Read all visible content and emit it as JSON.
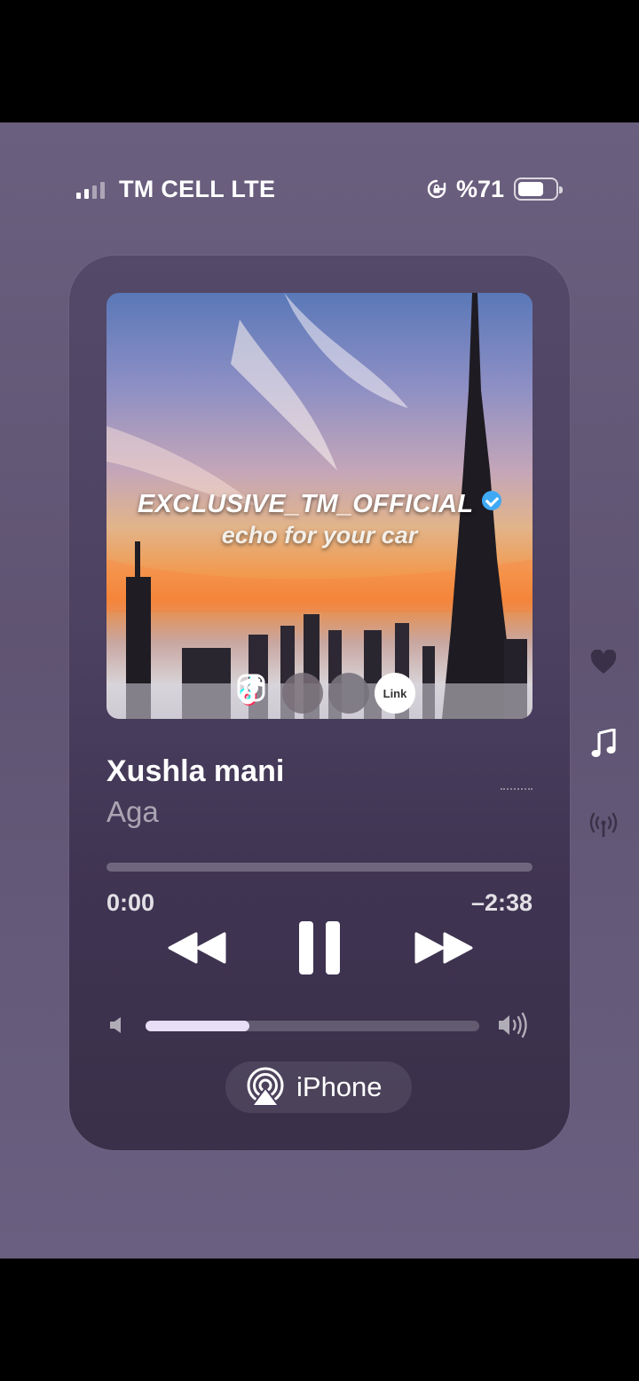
{
  "status_bar": {
    "carrier": "TM CELL LTE",
    "battery_percent": "%71",
    "battery_level": 0.71,
    "signal_bars": 2
  },
  "artwork": {
    "title": "EXCLUSIVE_TM_OFFICIAL",
    "subtitle": "echo for your car",
    "social_icons": [
      "tiktok-icon",
      "instagram-icon",
      "telegram-icon",
      "link-icon"
    ],
    "link_label": "Link"
  },
  "track": {
    "title": "Xushla mani",
    "artist": "Aga"
  },
  "playback": {
    "elapsed": "0:00",
    "remaining": "–2:38",
    "progress": 0.0,
    "state": "playing"
  },
  "volume": {
    "level": 0.31
  },
  "output": {
    "device": "iPhone"
  },
  "side_icons": [
    "heart-icon",
    "note-icon",
    "broadcast-icon"
  ],
  "colors": {
    "background": "#655a79",
    "card": "#4a3f5e",
    "volume_fill": "#e8def6",
    "verified": "#3fa9f5"
  }
}
